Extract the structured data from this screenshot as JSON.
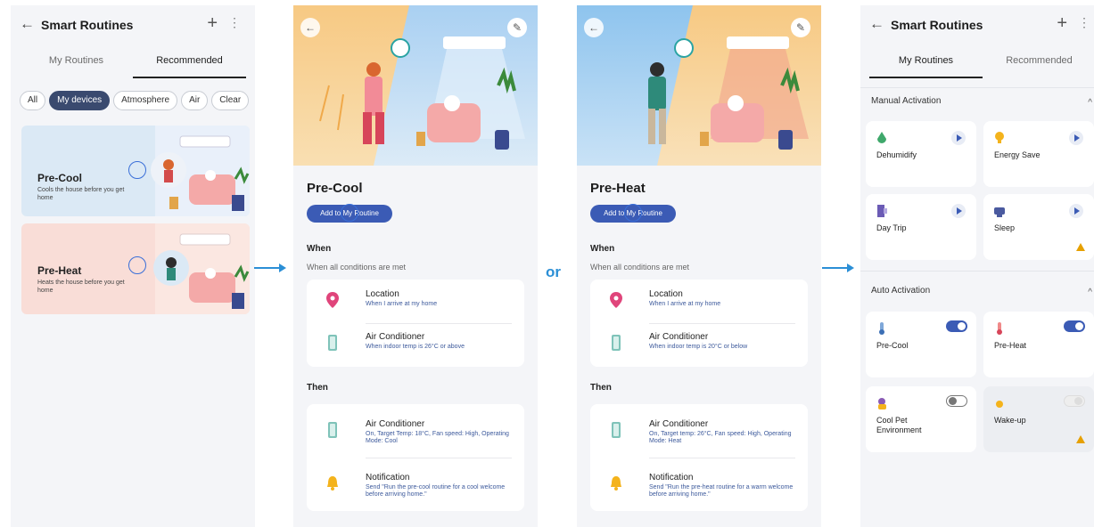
{
  "connector": {
    "or_label": "or"
  },
  "screen1": {
    "header": {
      "back": "←",
      "title": "Smart Routines",
      "plus": "+",
      "more": "⋮"
    },
    "tabs": [
      "My Routines",
      "Recommended"
    ],
    "chips": [
      "All",
      "My devices",
      "Atmosphere",
      "Air",
      "Clear"
    ],
    "cards": [
      {
        "title": "Pre-Cool",
        "desc": "Cools the house before you get home"
      },
      {
        "title": "Pre-Heat",
        "desc": "Heats the house before you get home"
      }
    ]
  },
  "precool": {
    "title": "Pre-Cool",
    "add_button": "Add to My Routine",
    "when": "When",
    "when_sub": "When all conditions are met",
    "then": "Then",
    "conditions": [
      {
        "title": "Location",
        "desc": "When I arrive at my home"
      },
      {
        "title": "Air Conditioner",
        "desc": "When indoor temp is 26°C or above"
      }
    ],
    "actions": [
      {
        "title": "Air Conditioner",
        "desc": "On, Target Temp: 18°C, Fan speed: High, Operating Mode: Cool"
      },
      {
        "title": "Notification",
        "desc": "Send \"Run the pre-cool routine for a cool welcome before arriving home.\""
      }
    ]
  },
  "preheat": {
    "title": "Pre-Heat",
    "add_button": "Add to My Routine",
    "when": "When",
    "when_sub": "When all conditions are met",
    "then": "Then",
    "conditions": [
      {
        "title": "Location",
        "desc": "When I arrive at my home"
      },
      {
        "title": "Air Conditioner",
        "desc": "When indoor temp is 20°C or below"
      }
    ],
    "actions": [
      {
        "title": "Air Conditioner",
        "desc": "On, Target temp: 26°C, Fan speed: High, Operating Mode: Heat"
      },
      {
        "title": "Notification",
        "desc": "Send \"Run the pre-heat routine for a warm welcome before arriving home.\""
      }
    ]
  },
  "screen4": {
    "header": {
      "back": "←",
      "title": "Smart Routines",
      "plus": "+",
      "more": "⋮"
    },
    "tabs": [
      "My Routines",
      "Recommended"
    ],
    "manual_label": "Manual Activation",
    "auto_label": "Auto Activation",
    "caret": "^",
    "manual": [
      "Dehumidify",
      "Energy Save",
      "Day Trip",
      "Sleep"
    ],
    "auto": [
      "Pre-Cool",
      "Pre-Heat",
      "Cool Pet Environment",
      "Wake-up"
    ]
  },
  "colors": {
    "accent": "#3b5bb5",
    "connector": "#2b8fd6",
    "warning": "#e6a000",
    "cool_bg": "#dbe9f5",
    "heat_bg": "#f9ddd7"
  }
}
